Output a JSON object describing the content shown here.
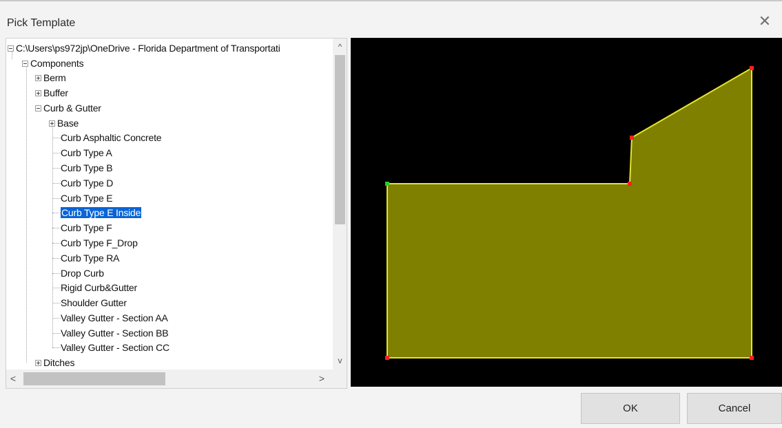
{
  "dialog": {
    "title": "Pick Template",
    "close_glyph": "✕"
  },
  "tree": {
    "root_path": "C:\\Users\\ps972jp\\OneDrive - Florida Department of Transportati",
    "components": "Components",
    "berm": "Berm",
    "buffer": "Buffer",
    "curb_gutter": "Curb & Gutter",
    "base": "Base",
    "items": [
      "Curb Asphaltic Concrete",
      "Curb Type A",
      "Curb Type B",
      "Curb Type D",
      "Curb Type E",
      "Curb Type E Inside",
      "Curb Type F",
      "Curb Type F_Drop",
      "Curb Type RA",
      "Drop Curb",
      "Rigid Curb&Gutter",
      "Shoulder Gutter",
      "Valley Gutter - Section AA",
      "Valley Gutter - Section BB",
      "Valley Gutter - Section CC"
    ],
    "selected_item": "Curb Type E Inside",
    "ditches": "Ditches"
  },
  "scrollbars": {
    "up_glyph": "^",
    "down_glyph": "v",
    "left_glyph": "<",
    "right_glyph": ">"
  },
  "preview": {
    "background": "#000000",
    "fill_color": "#7f7f00",
    "outline_color": "#e6e62a",
    "point_color": "#ff2020",
    "start_point_color": "#22d022"
  },
  "buttons": {
    "ok": "OK",
    "cancel": "Cancel"
  }
}
